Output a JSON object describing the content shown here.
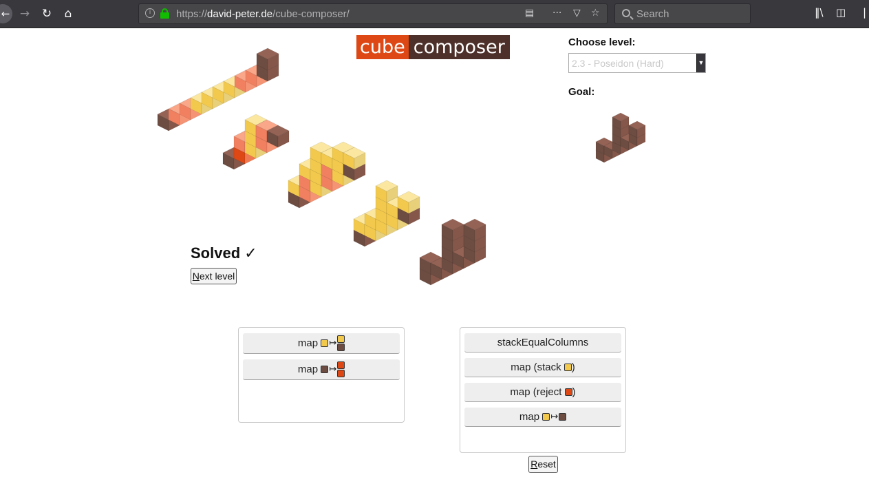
{
  "browser": {
    "url_prefix": "https://",
    "url_host": "david-peter.de",
    "url_path": "/cube-composer/",
    "search_placeholder": "Search"
  },
  "app": {
    "logo_left": "cube",
    "logo_right": "composer",
    "choose_level_label": "Choose level:",
    "level_selected": "2.3 - Poseidon (Hard)",
    "goal_label": "Goal:",
    "status": "Solved",
    "status_mark": "✓",
    "next_level_accel": "N",
    "next_level_rest": "ext level",
    "reset_accel": "R",
    "reset_rest": "eset"
  },
  "colors": {
    "yellow": "#f2c94c",
    "brown": "#6d4c41",
    "orange": "#dd4814",
    "salmon": "#f08060",
    "brand_orange": "#dd4814",
    "brand_brown": "#4d3029"
  },
  "available_functions": [
    {
      "label": "map",
      "from": "yellow",
      "to": [
        "yellow",
        "brown"
      ]
    },
    {
      "label": "map",
      "from": "brown",
      "to": [
        "orange",
        "orange"
      ]
    }
  ],
  "program": [
    {
      "label": "stackEqualColumns"
    },
    {
      "label": "map (stack ",
      "color": "yellow",
      "suffix": ")"
    },
    {
      "label": "map (reject ",
      "color": "orange",
      "suffix": ")"
    },
    {
      "label": "map",
      "from": "yellow",
      "to": [
        "brown"
      ]
    }
  ]
}
